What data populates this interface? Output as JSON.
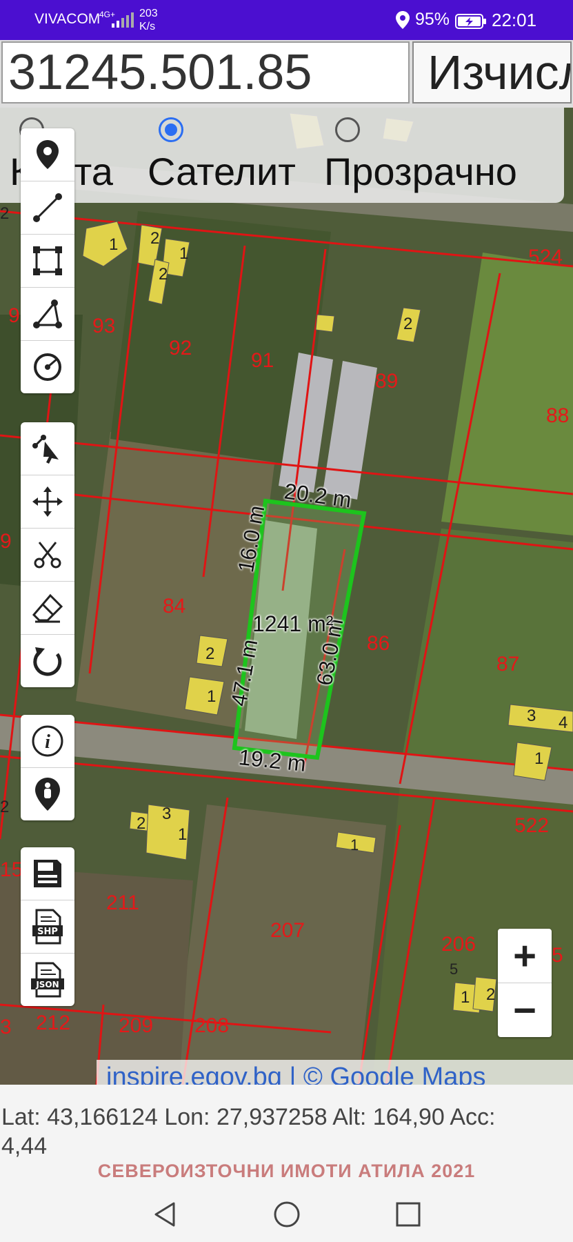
{
  "status_bar": {
    "carrier": "VIVACOM",
    "network": "4G+",
    "speed_value": "203",
    "speed_unit": "K/s",
    "battery": "95%",
    "time": "22:01"
  },
  "top": {
    "coordinate_value": "31245.501.85",
    "calculate_label": "Изчисл"
  },
  "layers": [
    {
      "label": "Карта",
      "selected": false
    },
    {
      "label": "Сателит",
      "selected": true
    },
    {
      "label": "Прозрачно",
      "selected": false
    }
  ],
  "toolbar_groups": [
    [
      "location-pin-icon",
      "line-measure-icon",
      "polygon-area-icon",
      "angle-icon",
      "circle-icon"
    ],
    [
      "edit-select-icon",
      "move-icon",
      "cut-icon",
      "eraser-icon",
      "undo-icon"
    ],
    [
      "info-icon",
      "person-location-icon"
    ],
    [
      "save-icon",
      "shp-export-icon",
      "json-export-icon"
    ]
  ],
  "map": {
    "parcel_labels": [
      "1",
      "2",
      "2",
      "2",
      "1",
      "2",
      "1",
      "2",
      "93",
      "92",
      "91",
      "89",
      "88",
      "524",
      "84",
      "86",
      "87",
      "522",
      "211",
      "207",
      "206",
      "212",
      "209",
      "208",
      "1",
      "2",
      "3",
      "1",
      "2",
      "3",
      "4",
      "1",
      "5",
      "1",
      "2",
      "9",
      "9",
      "15",
      "3",
      "5"
    ],
    "measurement": {
      "top_edge": "20.2 m",
      "left_upper": "16.0 m",
      "left_lower": "47.1 m",
      "right_edge": "63.0 m",
      "bottom_edge": "19.2 m",
      "area": "1241 m²"
    },
    "attribution": "inspire.egov.bg | © Google Maps"
  },
  "zoom": {
    "in": "+",
    "out": "−"
  },
  "gps": {
    "line1": "Lat: 43,166124 Lon: 27,937258 Alt: 164,90 Acc:",
    "line2": "4,44"
  },
  "footer_title": "СЕВЕРОИЗТОЧНИ ИМОТИ АТИЛА 2021"
}
